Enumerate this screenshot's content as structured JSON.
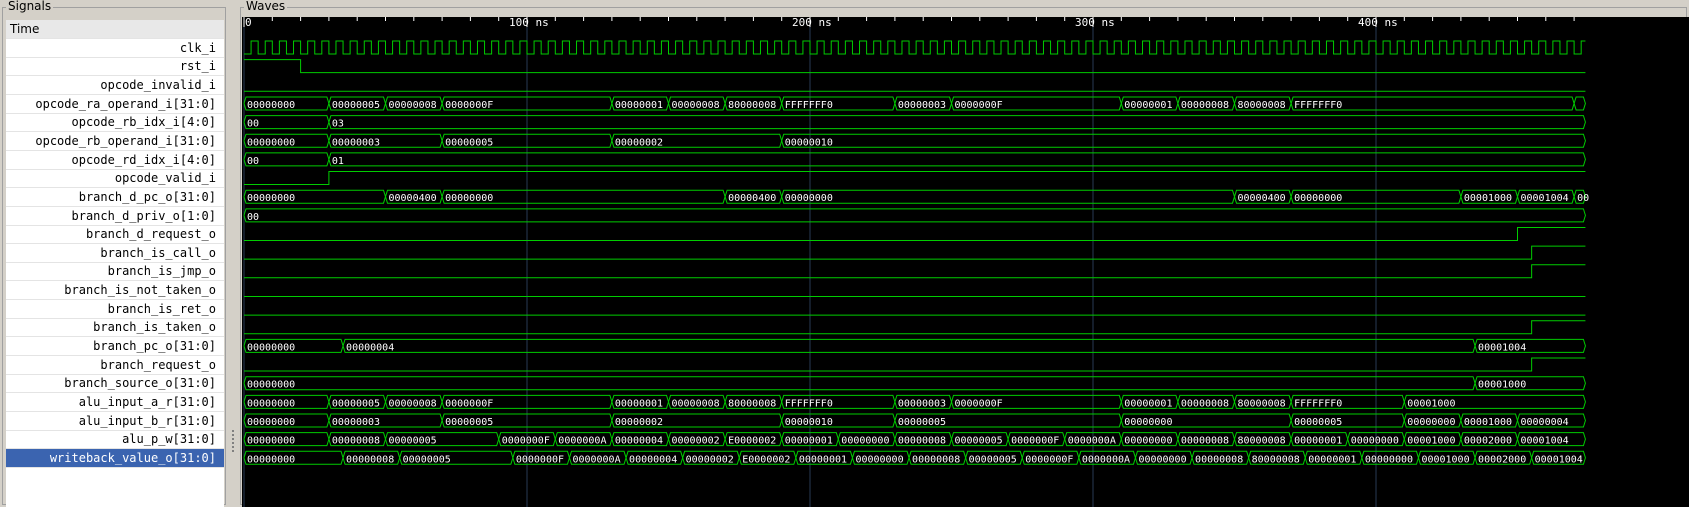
{
  "panels": {
    "signals_title": "Signals",
    "waves_title": "Waves"
  },
  "signal_list": {
    "header": "Time",
    "selected_index": 22
  },
  "colors": {
    "wave_bg": "#000000",
    "trace": "#00cc00",
    "label": "#ffffff",
    "grid": "#283a55",
    "selected": "#3b64b0"
  },
  "timeline": {
    "unit": "ns",
    "major_ticks": [
      0,
      100,
      200,
      300,
      400
    ],
    "visible_end_ns": 474,
    "clock_period_ns": 5
  },
  "signals": [
    {
      "name": "clk_i",
      "kind": "clock"
    },
    {
      "name": "rst_i",
      "kind": "bit",
      "init": 1,
      "edges": [
        20
      ]
    },
    {
      "name": "opcode_invalid_i",
      "kind": "bit",
      "init": 0,
      "edges": []
    },
    {
      "name": "opcode_ra_operand_i[31:0]",
      "kind": "bus",
      "segments": [
        [
          0,
          "00000000"
        ],
        [
          30,
          "00000005"
        ],
        [
          50,
          "00000008"
        ],
        [
          70,
          "0000000F"
        ],
        [
          130,
          "00000001"
        ],
        [
          150,
          "00000008"
        ],
        [
          170,
          "80000008"
        ],
        [
          190,
          "FFFFFFF0"
        ],
        [
          230,
          "00000003"
        ],
        [
          250,
          "0000000F"
        ],
        [
          310,
          "00000001"
        ],
        [
          330,
          "00000008"
        ],
        [
          350,
          "80000008"
        ],
        [
          370,
          "FFFFFFF0"
        ],
        [
          470,
          ""
        ]
      ]
    },
    {
      "name": "opcode_rb_idx_i[4:0]",
      "kind": "bus",
      "segments": [
        [
          0,
          "00"
        ],
        [
          30,
          "03"
        ]
      ]
    },
    {
      "name": "opcode_rb_operand_i[31:0]",
      "kind": "bus",
      "segments": [
        [
          0,
          "00000000"
        ],
        [
          30,
          "00000003"
        ],
        [
          70,
          "00000005"
        ],
        [
          130,
          "00000002"
        ],
        [
          190,
          "00000010"
        ]
      ]
    },
    {
      "name": "opcode_rd_idx_i[4:0]",
      "kind": "bus",
      "segments": [
        [
          0,
          "00"
        ],
        [
          30,
          "01"
        ]
      ]
    },
    {
      "name": "opcode_valid_i",
      "kind": "bit",
      "init": 0,
      "edges": [
        30
      ]
    },
    {
      "name": "branch_d_pc_o[31:0]",
      "kind": "bus",
      "segments": [
        [
          0,
          "00000000"
        ],
        [
          50,
          "00000400"
        ],
        [
          70,
          "00000000"
        ],
        [
          170,
          "00000400"
        ],
        [
          190,
          "00000000"
        ],
        [
          350,
          "00000400"
        ],
        [
          370,
          "00000000"
        ],
        [
          430,
          "00001000"
        ],
        [
          450,
          "00001004"
        ],
        [
          470,
          "00"
        ]
      ]
    },
    {
      "name": "branch_d_priv_o[1:0]",
      "kind": "bus",
      "segments": [
        [
          0,
          "00"
        ]
      ]
    },
    {
      "name": "branch_d_request_o",
      "kind": "bit",
      "init": 0,
      "edges": [
        450
      ]
    },
    {
      "name": "branch_is_call_o",
      "kind": "bit",
      "init": 0,
      "edges": [
        455
      ]
    },
    {
      "name": "branch_is_jmp_o",
      "kind": "bit",
      "init": 0,
      "edges": [
        455
      ]
    },
    {
      "name": "branch_is_not_taken_o",
      "kind": "bit",
      "init": 0,
      "edges": []
    },
    {
      "name": "branch_is_ret_o",
      "kind": "bit",
      "init": 0,
      "edges": []
    },
    {
      "name": "branch_is_taken_o",
      "kind": "bit",
      "init": 0,
      "edges": [
        455
      ]
    },
    {
      "name": "branch_pc_o[31:0]",
      "kind": "bus",
      "segments": [
        [
          0,
          "00000000"
        ],
        [
          35,
          "00000004"
        ],
        [
          435,
          "00001004"
        ]
      ]
    },
    {
      "name": "branch_request_o",
      "kind": "bit",
      "init": 0,
      "edges": [
        455
      ]
    },
    {
      "name": "branch_source_o[31:0]",
      "kind": "bus",
      "segments": [
        [
          0,
          "00000000"
        ],
        [
          435,
          "00001000"
        ]
      ]
    },
    {
      "name": "alu_input_a_r[31:0]",
      "kind": "bus",
      "segments": [
        [
          0,
          "00000000"
        ],
        [
          30,
          "00000005"
        ],
        [
          50,
          "00000008"
        ],
        [
          70,
          "0000000F"
        ],
        [
          130,
          "00000001"
        ],
        [
          150,
          "00000008"
        ],
        [
          170,
          "80000008"
        ],
        [
          190,
          "FFFFFFF0"
        ],
        [
          230,
          "00000003"
        ],
        [
          250,
          "0000000F"
        ],
        [
          310,
          "00000001"
        ],
        [
          330,
          "00000008"
        ],
        [
          350,
          "80000008"
        ],
        [
          370,
          "FFFFFFF0"
        ],
        [
          410,
          "00001000"
        ]
      ]
    },
    {
      "name": "alu_input_b_r[31:0]",
      "kind": "bus",
      "segments": [
        [
          0,
          "00000000"
        ],
        [
          30,
          "00000003"
        ],
        [
          70,
          "00000005"
        ],
        [
          130,
          "00000002"
        ],
        [
          190,
          "00000010"
        ],
        [
          230,
          "00000005"
        ],
        [
          310,
          "00000000"
        ],
        [
          370,
          "00000005"
        ],
        [
          410,
          "00000000"
        ],
        [
          430,
          "00001000"
        ],
        [
          450,
          "00000004"
        ]
      ]
    },
    {
      "name": "alu_p_w[31:0]",
      "kind": "bus",
      "segments": [
        [
          0,
          "00000000"
        ],
        [
          30,
          "00000008"
        ],
        [
          50,
          "00000005"
        ],
        [
          90,
          "0000000F"
        ],
        [
          110,
          "0000000A"
        ],
        [
          130,
          "00000004"
        ],
        [
          150,
          "00000002"
        ],
        [
          170,
          "E0000002"
        ],
        [
          190,
          "00000001"
        ],
        [
          210,
          "00000000"
        ],
        [
          230,
          "00000008"
        ],
        [
          250,
          "00000005"
        ],
        [
          270,
          "0000000F"
        ],
        [
          290,
          "0000000A"
        ],
        [
          310,
          "00000000"
        ],
        [
          330,
          "00000008"
        ],
        [
          350,
          "80000008"
        ],
        [
          370,
          "00000001"
        ],
        [
          390,
          "00000000"
        ],
        [
          410,
          "00001000"
        ],
        [
          430,
          "00002000"
        ],
        [
          450,
          "00001004"
        ]
      ]
    },
    {
      "name": "writeback_value_o[31:0]",
      "kind": "bus",
      "segments": [
        [
          0,
          "00000000"
        ],
        [
          35,
          "00000008"
        ],
        [
          55,
          "00000005"
        ],
        [
          95,
          "0000000F"
        ],
        [
          115,
          "0000000A"
        ],
        [
          135,
          "00000004"
        ],
        [
          155,
          "00000002"
        ],
        [
          175,
          "E0000002"
        ],
        [
          195,
          "00000001"
        ],
        [
          215,
          "00000000"
        ],
        [
          235,
          "00000008"
        ],
        [
          255,
          "00000005"
        ],
        [
          275,
          "0000000F"
        ],
        [
          295,
          "0000000A"
        ],
        [
          315,
          "00000000"
        ],
        [
          335,
          "00000008"
        ],
        [
          355,
          "80000008"
        ],
        [
          375,
          "00000001"
        ],
        [
          395,
          "00000000"
        ],
        [
          415,
          "00001000"
        ],
        [
          435,
          "00002000"
        ],
        [
          455,
          "00001004"
        ]
      ]
    }
  ]
}
